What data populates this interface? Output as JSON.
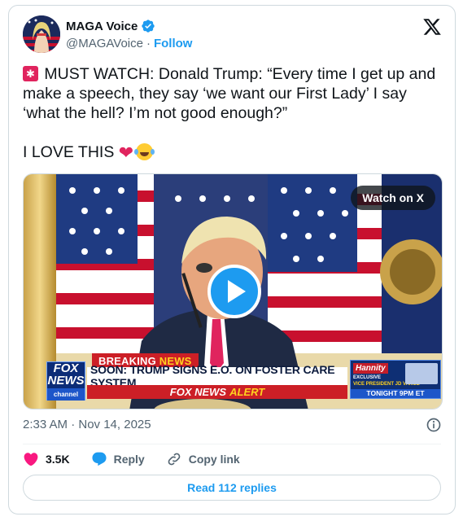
{
  "author": {
    "name": "MAGA Voice",
    "handle": "@MAGAVoice",
    "separator": "·",
    "follow_label": "Follow",
    "verified": true
  },
  "tweet": {
    "line1": " MUST WATCH: Donald Trump: “Every time I get up and make a speech, they say ‘we want our First Lady’ I say ‘what the hell? I’m not good enough?”",
    "line2": "I LOVE THIS "
  },
  "video": {
    "watch_label": "Watch on X",
    "chyron": {
      "breaking": "BREAKING",
      "breaking_news": "NEWS",
      "headline": "SOON: TRUMP SIGNS E.O. ON FOSTER CARE SYSTEM",
      "alert_brand": "FOX NEWS",
      "alert_word": "ALERT",
      "channel_top": "FOX",
      "channel_mid": "NEWS",
      "channel_bottom": "channel",
      "promo_show": "Hannity",
      "promo_exclusive": "EXCLUSIVE",
      "promo_guest": "VICE PRESIDENT JD VANCE",
      "promo_time": "TONIGHT 9PM ET"
    }
  },
  "meta": {
    "timestamp": "2:33 AM · Nov 14, 2025"
  },
  "actions": {
    "likes": "3.5K",
    "reply_label": "Reply",
    "copy_label": "Copy link"
  },
  "read_replies_label": "Read 112 replies",
  "colors": {
    "accent": "#1d9bf0",
    "like": "#f91880",
    "text_secondary": "#536471"
  }
}
